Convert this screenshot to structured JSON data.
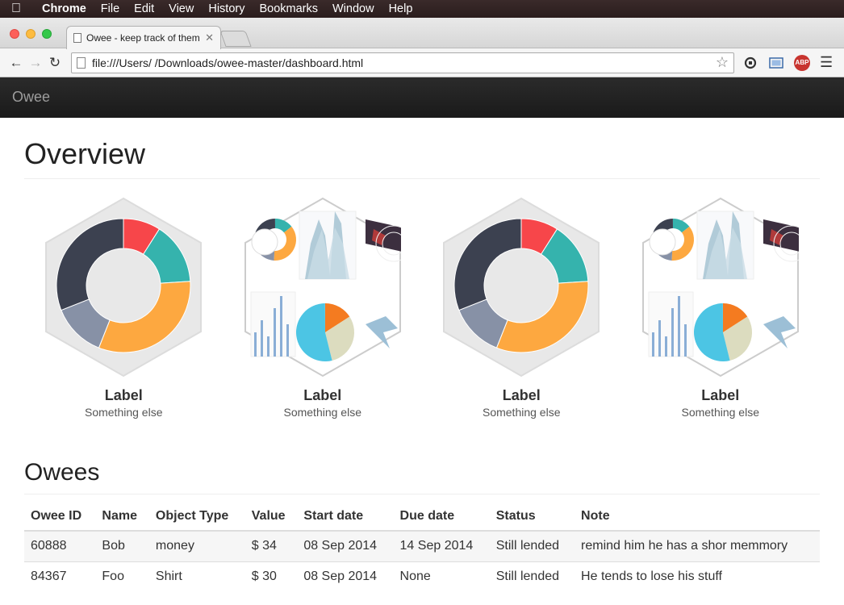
{
  "menubar": {
    "items": [
      "Chrome",
      "File",
      "Edit",
      "View",
      "History",
      "Bookmarks",
      "Window",
      "Help"
    ]
  },
  "browser": {
    "tab_title": "Owee - keep track of them",
    "url": "file:///Users/  /Downloads/owee-master/dashboard.html"
  },
  "app": {
    "brand": "Owee"
  },
  "overview": {
    "title": "Overview",
    "cards": [
      {
        "label": "Label",
        "sub": "Something else",
        "kind": "donut"
      },
      {
        "label": "Label",
        "sub": "Something else",
        "kind": "collage"
      },
      {
        "label": "Label",
        "sub": "Something else",
        "kind": "donut"
      },
      {
        "label": "Label",
        "sub": "Something else",
        "kind": "collage"
      }
    ],
    "donut_colors": [
      "#f7464a",
      "#35b3ad",
      "#fda840",
      "#8791a6",
      "#3c4150"
    ]
  },
  "owees": {
    "title": "Owees",
    "columns": [
      "Owee ID",
      "Name",
      "Object Type",
      "Value",
      "Start date",
      "Due date",
      "Status",
      "Note"
    ],
    "rows": [
      [
        "60888",
        "Bob",
        "money",
        "$ 34",
        "08 Sep 2014",
        "14 Sep 2014",
        "Still lended",
        "remind him he has a shor memmory"
      ],
      [
        "84367",
        "Foo",
        "Shirt",
        "$ 30",
        "08 Sep 2014",
        "None",
        "Still lended",
        "He tends to lose his stuff"
      ]
    ]
  }
}
